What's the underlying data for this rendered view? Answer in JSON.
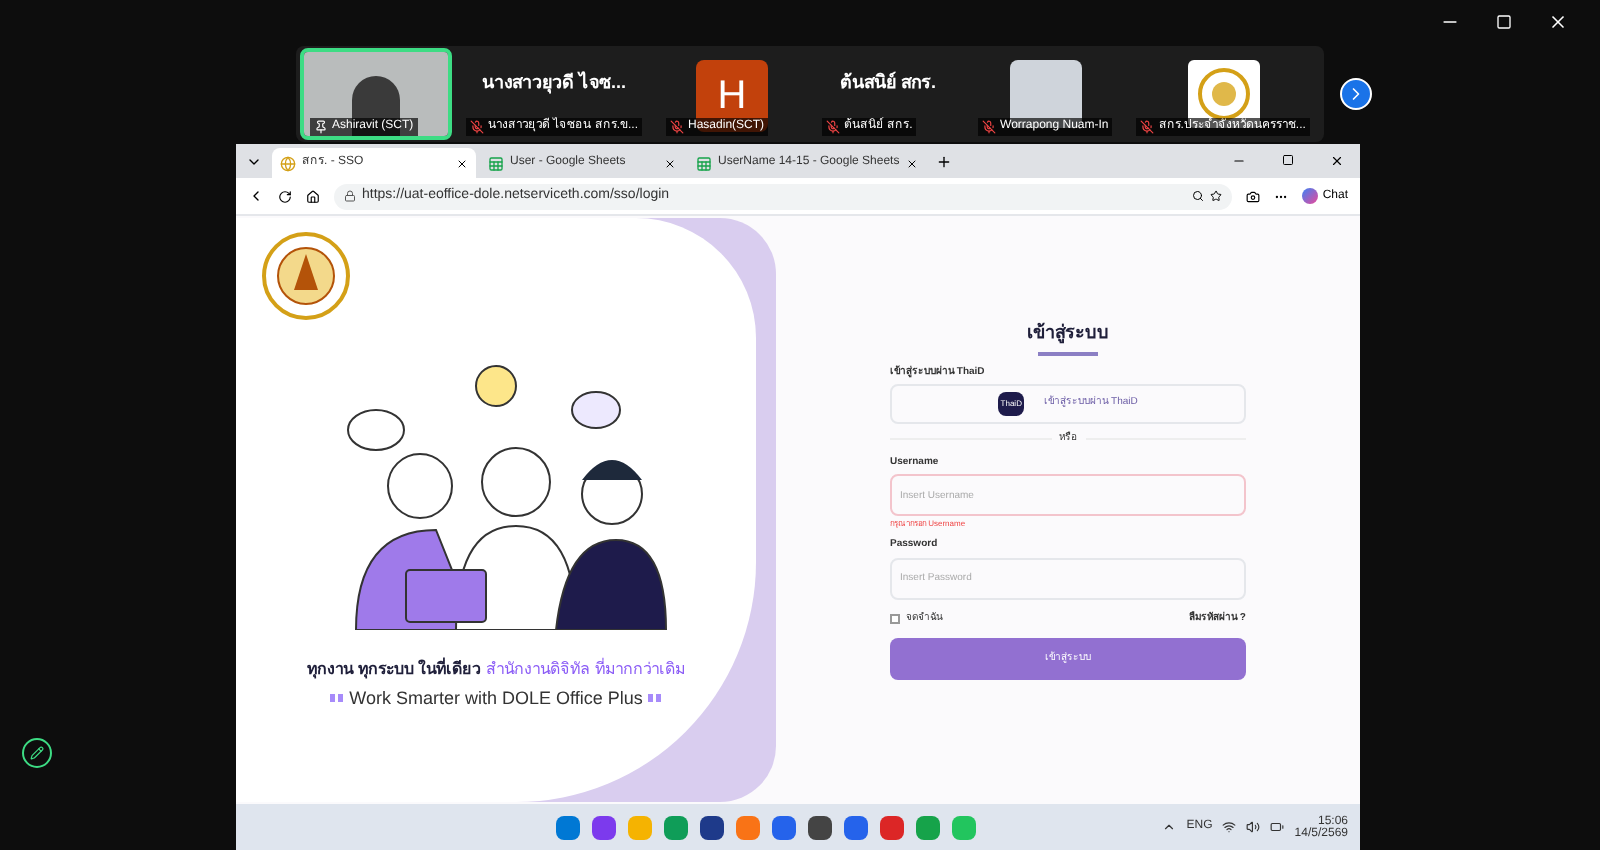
{
  "participants": [
    {
      "kind": "video",
      "label": "Ashiravit (SCT)",
      "speaking": true
    },
    {
      "kind": "name",
      "display": "นางสาวยุวดี ไจซ...",
      "label": "นางสาวยุวดี ไจซอน สกร.ข...",
      "speaking": false
    },
    {
      "kind": "avatar",
      "display": "H",
      "label": "Hasadin(SCT)",
      "speaking": false
    },
    {
      "kind": "name",
      "display": "ต้นสนิย์ สกร.",
      "label": "ต้นสนิย์ สกร.",
      "speaking": false
    },
    {
      "kind": "photo",
      "label": "Worrapong Nuam-In",
      "speaking": false
    },
    {
      "kind": "logo",
      "label": "สกร.ประจำจังหวัดนครราช...",
      "speaking": false
    }
  ],
  "browser": {
    "tabs": [
      {
        "label": "สกร. - SSO",
        "kind": "site",
        "selected": true
      },
      {
        "label": "User - Google Sheets",
        "kind": "sheets",
        "selected": false
      },
      {
        "label": "UserName 14-15 - Google Sheets",
        "kind": "sheets",
        "selected": false
      }
    ],
    "url": "https://uat-eoffice-dole.netserviceth.com/sso/login",
    "copilot_label": "Chat"
  },
  "hero": {
    "tagline_start": "ทุกงาน ทุกระบบ ในที่เดียว",
    "tagline_accent": "สำนักงานดิจิทัล ที่มากกว่าเดิม",
    "slogan": "Work Smarter with DOLE Office Plus"
  },
  "login": {
    "title": "เข้าสู่ระบบ",
    "thaid_label": "เข้าสู่ระบบผ่าน ThaiD",
    "thaid_logo": "ThaiD",
    "thaid_button": "เข้าสู่ระบบผ่าน ThaiD",
    "divider": "หรือ",
    "username": {
      "label": "Username",
      "placeholder": "Insert Username",
      "error": "กรุณากรอก Username"
    },
    "password": {
      "label": "Password",
      "placeholder": "Insert Password"
    },
    "remember": {
      "label": "จดจำฉัน",
      "checked": false
    },
    "forgot": "ลืมรหัสผ่าน ?",
    "submit": "เข้าสู่ระบบ"
  },
  "taskbar": {
    "language": "ENG",
    "time": "15:06",
    "date": "14/5/2569"
  }
}
